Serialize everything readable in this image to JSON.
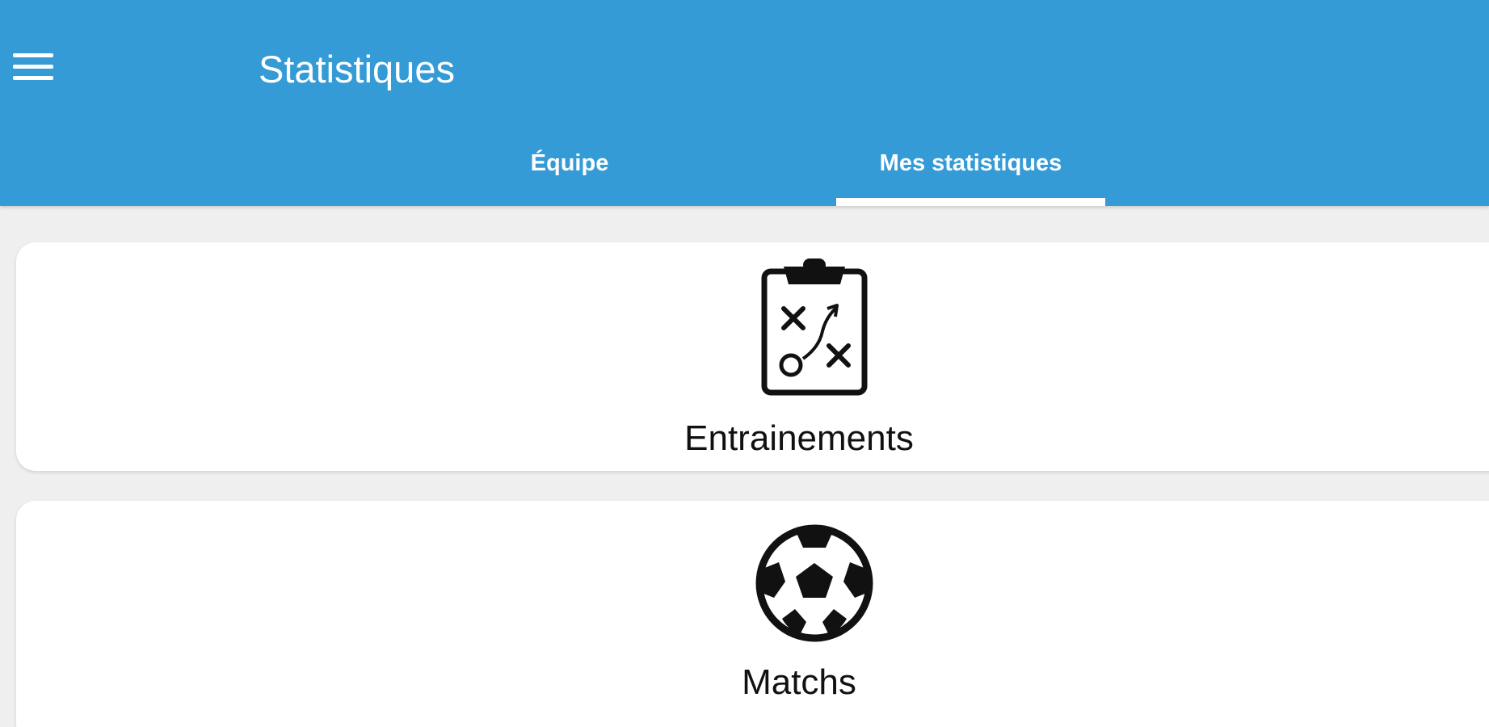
{
  "appbar": {
    "title": "Statistiques",
    "menu_icon": "hamburger-menu-icon",
    "color": "#349bd7"
  },
  "tabs": [
    {
      "label": "Équipe",
      "selected": false
    },
    {
      "label": "Mes statistiques",
      "selected": true
    }
  ],
  "cards": [
    {
      "label": "Entrainements",
      "icon": "tactics-clipboard-icon"
    },
    {
      "label": "Matchs",
      "icon": "soccer-ball-icon"
    }
  ]
}
